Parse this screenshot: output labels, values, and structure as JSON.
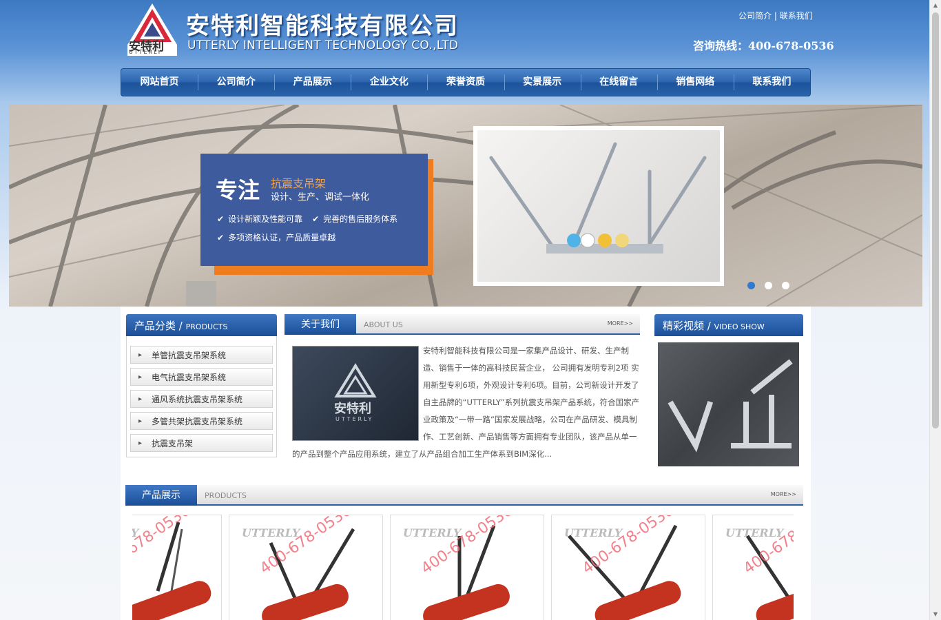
{
  "header": {
    "company_cn": "安特利智能科技有限公司",
    "company_en": "UTTERLY INTELLIGENT TECHNOLOGY CO.,LTD",
    "logo_text_cn": "安特利",
    "logo_text_en": "UTTERLY",
    "top_link_about": "公司简介",
    "top_link_separator": "|",
    "top_link_contact": "联系我们",
    "hotline": "咨询热线：400-678-0536"
  },
  "nav": {
    "items": [
      "网站首页",
      "公司简介",
      "产品展示",
      "企业文化",
      "荣誉资质",
      "实景展示",
      "在线留言",
      "销售网络",
      "联系我们"
    ]
  },
  "banner": {
    "big_word": "专注",
    "title": "抗震支吊架",
    "subtitle": "设计、生产、调试一体化",
    "point1": "设计新颖及性能可靠",
    "point2": "完善的售后服务体系",
    "point3": "多项资格认证，产品质量卓越",
    "active_slide": 1,
    "slide_count": 3
  },
  "categories": {
    "title_cn": "产品分类",
    "slash": "/",
    "title_en": "PRODUCTS",
    "items": [
      "单管抗震支吊架系统",
      "电气抗震支吊架系统",
      "通风系统抗震支吊架系统",
      "多管共架抗震支吊架系统",
      "抗震支吊架"
    ]
  },
  "about": {
    "tab": "关于我们",
    "en": "ABOUT  US",
    "more": "MORE>>",
    "text": "安特利智能科技有限公司是一家集产品设计、研发、生产制造、销售于一体的高科技民营企业， 公司拥有发明专利2项 实用新型专利6项，外观设计专利6项。目前，公司新设计开发了自主品牌的“UTTERLY”系列抗震支吊架产品系统，符合国家产业政策及“一带一路”国家发展战略，公司在产品研发、模具制作、工艺创新、产品销售等方面拥有专业团队，该产品从单一的产品到整个产品应用系统，建立了从产品组合加工生产体系到BIM深化..."
  },
  "video": {
    "title_cn": "精彩视频",
    "slash": "/",
    "title_en": "VIDEO SHOW"
  },
  "products": {
    "tab": "产品展示",
    "en": "PRODUCTS",
    "more": "MORE>>",
    "brand": "UTTERLY",
    "watermark": "400-678-0536"
  },
  "colors": {
    "nav_blue": "#2d66ae",
    "banner_panel": "#3e5b9e",
    "banner_orange": "#ef7d20",
    "watermark_pink": "#f06d79"
  }
}
